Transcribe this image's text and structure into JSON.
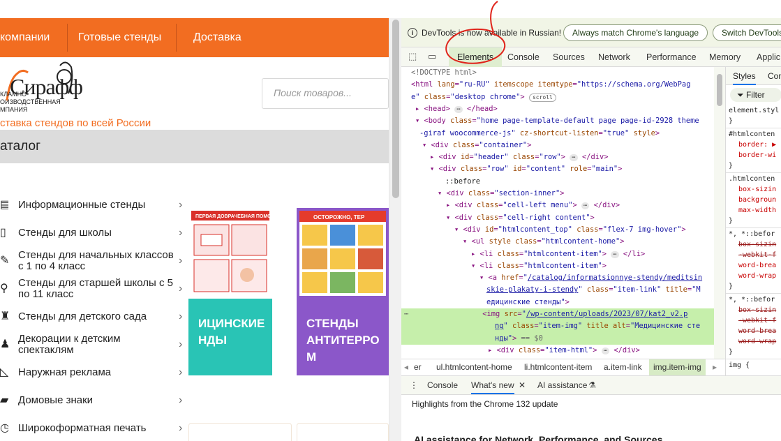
{
  "site": {
    "nav": [
      "компании",
      "Готовые стенды",
      "Доставка"
    ],
    "logo": {
      "word": "Сирафф",
      "sub_lines": [
        "КЛАМНО-",
        "ОИЗВОДСТВЕННАЯ",
        "МПАНИЯ"
      ],
      "tagline": "ставка стендов по всей России"
    },
    "search_placeholder": "Поиск товаров...",
    "catalog_title": "аталог",
    "categories": [
      {
        "label": "Информационные стенды",
        "icon": "board-icon"
      },
      {
        "label": "Стенды для школы",
        "icon": "book-icon"
      },
      {
        "label": "Стенды для начальных классов с 1 по 4 класс",
        "icon": "pencil-icon"
      },
      {
        "label": "Стенды для старшей школы с 5 по 11 класс",
        "icon": "compass-icon"
      },
      {
        "label": "Стенды для детского сада",
        "icon": "toy-icon"
      },
      {
        "label": "Декорации к детским спектаклям",
        "icon": "theater-icon"
      },
      {
        "label": "Наружная реклама",
        "icon": "megaphone-icon"
      },
      {
        "label": "Домовые знаки",
        "icon": "sign-icon"
      },
      {
        "label": "Широкоформатная печать",
        "icon": "printer-icon"
      }
    ],
    "cards": [
      {
        "title": "ицинские нды",
        "color": "#29c4b5",
        "img_heading": "ПЕРВАЯ ДОВРАЧЕБНАЯ ПОМОЩЬ"
      },
      {
        "title": "СТЕНДЫ АНТИТЕРРО М",
        "color": "#8b57c9",
        "img_heading": "ОСТОРОЖНО, ТЕР"
      }
    ]
  },
  "devtools": {
    "info_text": "DevTools is now available in Russian!",
    "info_buttons": [
      "Always match Chrome's language",
      "Switch DevTools"
    ],
    "tabs": [
      "Elements",
      "Console",
      "Sources",
      "Network",
      "Performance",
      "Memory",
      "Applic"
    ],
    "active_tab": "Elements",
    "styles_tabs": [
      "Styles",
      "Con"
    ],
    "styles_filter": "Filter",
    "breadcrumbs": [
      "er",
      "ul.htmlcontent-home",
      "li.htmlcontent-item",
      "a.item-link",
      "img.item-img"
    ],
    "drawer_tabs": [
      "Console",
      "What's new",
      "AI assistance"
    ],
    "drawer_text": "Highlights from the Chrome 132 update",
    "drawer_heading": "AI assistance for Network, Performance, and Sources",
    "dom_lines": [
      "<!DOCTYPE html>",
      "<html lang=\"ru-RU\" itemscope itemtype=\"https://schema.org/WebPage\" class=\"desktop chrome\">",
      "<head> … </head>",
      "<body class=\"home page-template-default page page-id-2928 theme-giraf woocommerce-js\" cz-shortcut-listen=\"true\" style>",
      "<div class=\"container\">",
      "<div id=\"header\" class=\"row\"> … </div>",
      "<div class=\"row\" id=\"content\" role=\"main\">",
      "::before",
      "<div class=\"section-inner\">",
      "<div class=\"cell-left menu\"> … </div>",
      "<div class=\"cell-right content\">",
      "<div id=\"htmlcontent_top\" class=\"flex-7 img-hover\">",
      "<ul style class=\"htmlcontent-home\">",
      "<li class=\"htmlcontent-item\"> … </li>",
      "<li class=\"htmlcontent-item\">",
      "<a href=\"/catalog/informatsionnye-stendy/meditsinskie-plakaty-i-stendy\" class=\"item-link\" title=\"Медицинские стенды\">",
      "<img src=\"/wp-content/uploads/2023/07/kat2_v2.png\" class=\"item-img\" title alt=\"Медицинские стенды\"> == $0",
      "<div class=\"item-html\"> … </div>"
    ],
    "scroll_badge": "scroll",
    "styles_lines": [
      "element.styl",
      "}",
      "#htmlconten",
      "border: ▶",
      "border-wi",
      "}",
      ".htmlconten",
      "box-sizin",
      "backgroun",
      "max-width",
      "}",
      "*, *::befor",
      "box-sizin",
      "-webkit-f",
      "word-brea",
      "word-wrap",
      "}",
      "*, *::befor",
      "box-sizin",
      "-webkit-f",
      "word-brea",
      "word-wrap",
      "}",
      "img {"
    ],
    "accent_color": "#1a73e8"
  }
}
